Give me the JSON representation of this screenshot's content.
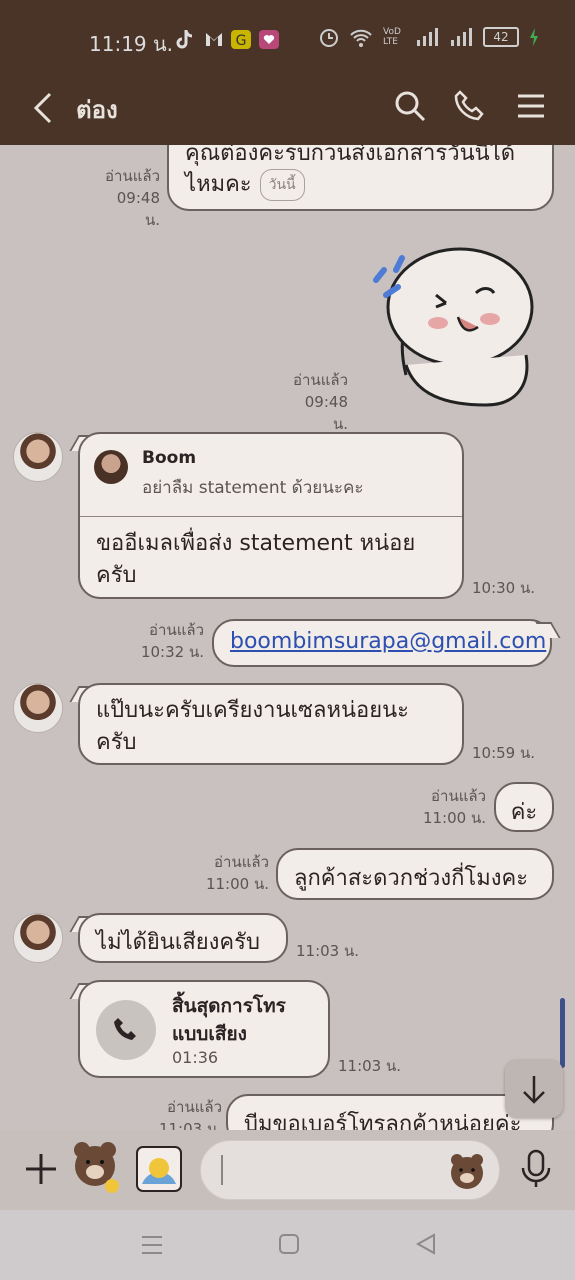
{
  "status": {
    "time": "11:19 น.",
    "battery": "42",
    "signal_label": "VoD LTE"
  },
  "header": {
    "title": "ต่อง"
  },
  "messages": {
    "m1": {
      "text_line1": "คุณต่องคะรบกวนส่งเอกสารวันนี้ได้",
      "text_line2": "ไหมคะ",
      "date_pill": "วันนี้",
      "read": "อ่านแล้ว",
      "time": "09:48 น."
    },
    "m2": {
      "read": "อ่านแล้ว",
      "time": "09:48 น."
    },
    "m3": {
      "reply_name": "Boom",
      "reply_text": "อย่าลืม statement ด้วยนะคะ",
      "text_line1": "ขออีเมลเพื่อส่ง statement หน่อย",
      "text_line2": "ครับ",
      "time": "10:30 น."
    },
    "m4": {
      "text": "boombimsurapa@gmail.com",
      "read": "อ่านแล้ว",
      "time": "10:32 น."
    },
    "m5": {
      "text_line1": "แป๊บนะครับเครียงานเซลหน่อยนะ",
      "text_line2": "ครับ",
      "time": "10:59 น."
    },
    "m6": {
      "text": "ค่ะ",
      "read": "อ่านแล้ว",
      "time": "11:00 น."
    },
    "m7": {
      "text": "ลูกค้าสะดวกช่วงกี่โมงคะ",
      "read": "อ่านแล้ว",
      "time": "11:00 น."
    },
    "m8": {
      "text": "ไม่ได้ยินเสียงครับ",
      "time": "11:03 น."
    },
    "m9": {
      "title_line1": "สิ้นสุดการโทร",
      "title_line2": "แบบเสียง",
      "duration": "01:36",
      "time": "11:03 น."
    },
    "m10": {
      "text": "บีมขอเบอร์โทรลูกค้าหน่อยค่ะ",
      "read": "อ่านแล้ว",
      "time": "11:03 น."
    }
  },
  "colors": {
    "header_bg": "#4a3428",
    "chat_bg": "#c8c1bf",
    "bubble_bg": "#f3ede9",
    "link": "#2c4fb0"
  }
}
